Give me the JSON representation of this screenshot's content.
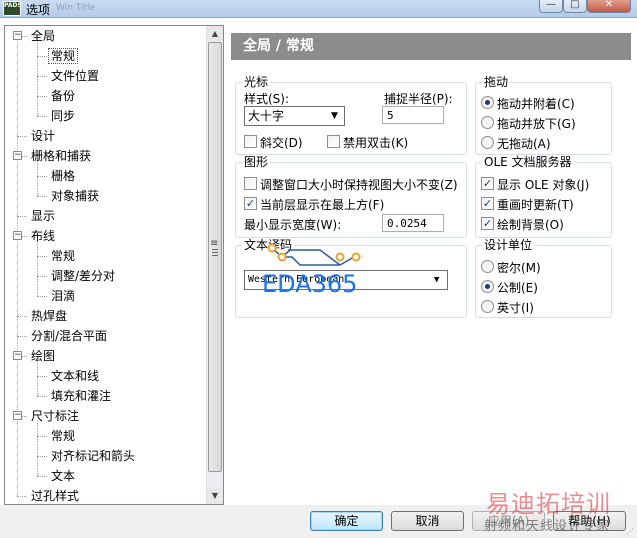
{
  "window": {
    "icon_text": "PADS",
    "title": "选项",
    "title_faded": "Win Title",
    "minimize_glyph": "—",
    "maximize_glyph": "□",
    "close_glyph": "✕"
  },
  "tree": {
    "collapse_glyph": "−",
    "items": [
      {
        "label": "全局",
        "level": 0,
        "expanded": true
      },
      {
        "label": "常规",
        "level": 1,
        "selected": true
      },
      {
        "label": "文件位置",
        "level": 1
      },
      {
        "label": "备份",
        "level": 1
      },
      {
        "label": "同步",
        "level": 1
      },
      {
        "label": "设计",
        "level": 0
      },
      {
        "label": "栅格和捕获",
        "level": 0,
        "expanded": true
      },
      {
        "label": "栅格",
        "level": 1
      },
      {
        "label": "对象捕获",
        "level": 1
      },
      {
        "label": "显示",
        "level": 0
      },
      {
        "label": "布线",
        "level": 0,
        "expanded": true
      },
      {
        "label": "常规",
        "level": 1
      },
      {
        "label": "调整/差分对",
        "level": 1
      },
      {
        "label": "泪滴",
        "level": 1
      },
      {
        "label": "热焊盘",
        "level": 0
      },
      {
        "label": "分割/混合平面",
        "level": 0
      },
      {
        "label": "绘图",
        "level": 0,
        "expanded": true
      },
      {
        "label": "文本和线",
        "level": 1
      },
      {
        "label": "填充和灌注",
        "level": 1
      },
      {
        "label": "尺寸标注",
        "level": 0,
        "expanded": true
      },
      {
        "label": "常规",
        "level": 1
      },
      {
        "label": "对齐标记和箭头",
        "level": 1
      },
      {
        "label": "文本",
        "level": 1
      },
      {
        "label": "过孔样式",
        "level": 0
      }
    ],
    "scroll_up_glyph": "▲",
    "scroll_down_glyph": "▼"
  },
  "splitter_glyph": "≡",
  "page": {
    "header": "全局 / 常规"
  },
  "cursor_group": {
    "title": "光标",
    "style_label": "样式(S):",
    "style_value": "大十字",
    "snap_radius_label": "捕捉半径(P):",
    "snap_radius_value": "5",
    "diagonal_label": "斜交(D)",
    "diagonal_checked": false,
    "no_double_click_label": "禁用双击(K)",
    "no_double_click_checked": false,
    "combo_arrow": "▼"
  },
  "drag_group": {
    "title": "拖动",
    "options": [
      {
        "label": "拖动并附着(C)",
        "selected": true
      },
      {
        "label": "拖动并放下(G)",
        "selected": false
      },
      {
        "label": "无拖动(A)",
        "selected": false
      }
    ]
  },
  "graphics_group": {
    "title": "图形",
    "keep_view_label": "调整窗口大小时保持视图大小不变(Z)",
    "keep_view_checked": false,
    "current_layer_top_label": "当前层显示在最上方(F)",
    "current_layer_top_checked": true,
    "min_width_label": "最小显示宽度(W):",
    "min_width_value": "0.0254",
    "check_glyph": "✓"
  },
  "ole_group": {
    "title": "OLE 文档服务器",
    "options": [
      {
        "label": "显示 OLE 对象(J)",
        "checked": true
      },
      {
        "label": "重画时更新(T)",
        "checked": true
      },
      {
        "label": "绘制背景(O)",
        "checked": true
      }
    ]
  },
  "text_encoding_group": {
    "title": "文本译码",
    "value": "Western European",
    "combo_arrow": "▼"
  },
  "design_units_group": {
    "title": "设计单位",
    "options": [
      {
        "label": "密尔(M)",
        "selected": false
      },
      {
        "label": "公制(E)",
        "selected": true
      },
      {
        "label": "英寸(I)",
        "selected": false
      }
    ]
  },
  "buttons": {
    "ok": "确定",
    "cancel": "取消",
    "apply": "应用(A)",
    "help": "帮助(H)"
  },
  "resize_grip_glyph": "⋰",
  "watermarks": {
    "eda": "EDA365",
    "brand": "易迪拓培训",
    "sub": "射频和天线设计专家"
  },
  "colors": {
    "header_bar": "#8c8c8c",
    "selection_border": "#3c7fb1"
  }
}
